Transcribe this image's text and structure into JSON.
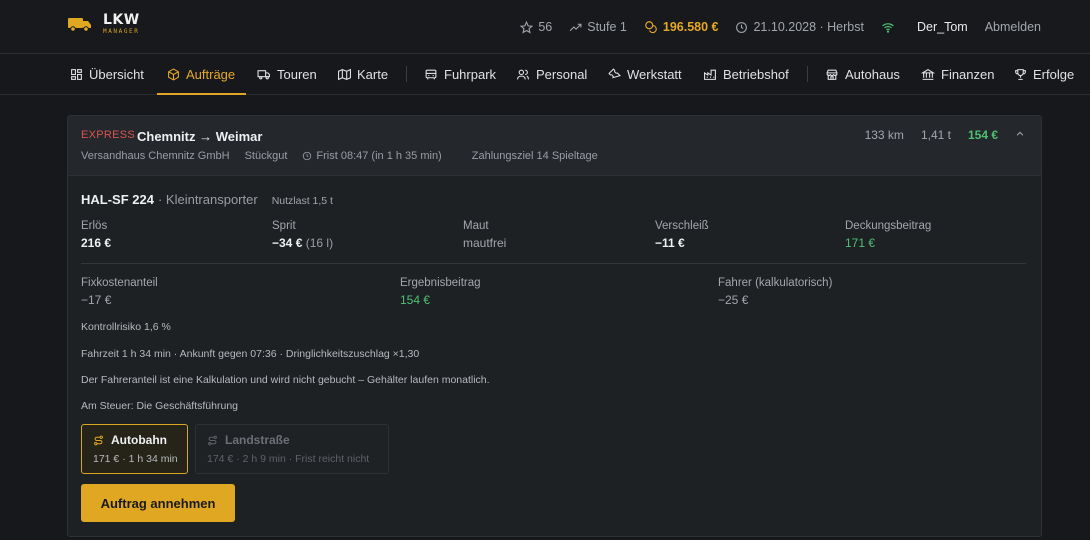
{
  "app": {
    "logo_main": "LKW",
    "logo_sub": "MANAGER"
  },
  "header": {
    "rating": "56",
    "level": "Stufe 1",
    "money": "196.580 €",
    "date": "21.10.2028 · Herbst",
    "username": "Der_Tom",
    "logout": "Abmelden"
  },
  "nav": {
    "items": [
      {
        "label": "Übersicht",
        "icon": "dashboard-icon"
      },
      {
        "label": "Aufträge",
        "icon": "box-icon",
        "active": true
      },
      {
        "label": "Touren",
        "icon": "truck-icon"
      },
      {
        "label": "Karte",
        "icon": "map-icon"
      },
      {
        "label": "Fuhrpark",
        "icon": "fleet-icon"
      },
      {
        "label": "Personal",
        "icon": "users-icon"
      },
      {
        "label": "Werkstatt",
        "icon": "wrench-icon"
      },
      {
        "label": "Betriebshof",
        "icon": "depot-icon"
      },
      {
        "label": "Autohaus",
        "icon": "store-icon"
      },
      {
        "label": "Finanzen",
        "icon": "bank-icon"
      },
      {
        "label": "Erfolge",
        "icon": "trophy-icon"
      }
    ]
  },
  "order": {
    "badge": "EXPRESS",
    "route": "Chemnitz → Weimar",
    "client": "Versandhaus Chemnitz GmbH",
    "cargo": "Stückgut",
    "deadline": "Frist 08:47 (in 1 h 35 min)",
    "payment": "Zahlungsziel 14 Spieltage",
    "distance": "133 km",
    "weight": "1,41 t",
    "earning": "154 €"
  },
  "vehicle": {
    "plate": "HAL-SF 224",
    "type": "· Kleintransporter",
    "payload": "Nutzlast 1,5 t"
  },
  "calc": {
    "revenue_label": "Erlös",
    "revenue": "216 €",
    "fuel_label": "Sprit",
    "fuel": "−34 €",
    "fuel_sub": "(16 l)",
    "toll_label": "Maut",
    "toll": "mautfrei",
    "wear_label": "Verschleiß",
    "wear": "−11 €",
    "contribution_label": "Deckungsbeitrag",
    "contribution": "171 €",
    "fixed_label": "Fixkostenanteil",
    "fixed": "−17 €",
    "result_label": "Ergebnisbeitrag",
    "result": "154 €",
    "driver_label": "Fahrer (kalkulatorisch)",
    "driver": "−25 €"
  },
  "notes": {
    "risk": "Kontrollrisiko 1,6 %",
    "timing": "Fahrzeit 1 h 34 min · Ankunft gegen 07:36 · Dringlichkeitszuschlag ×1,30",
    "driver_note": "Der Fahreranteil ist eine Kalkulation und wird nicht gebucht – Gehälter laufen monatlich.",
    "driver_assigned": "Am Steuer: Die Geschäftsführung"
  },
  "routes": {
    "autobahn": {
      "label": "Autobahn",
      "detail": "171 € · 1 h 34 min"
    },
    "landstrasse": {
      "label": "Landstraße",
      "detail": "174 € · 2 h 9 min · Frist reicht nicht"
    }
  },
  "actions": {
    "accept": "Auftrag annehmen"
  },
  "colors": {
    "accent": "#dfa722",
    "positive": "#4fbf73",
    "express": "#d9534f",
    "background": "#16181b"
  }
}
